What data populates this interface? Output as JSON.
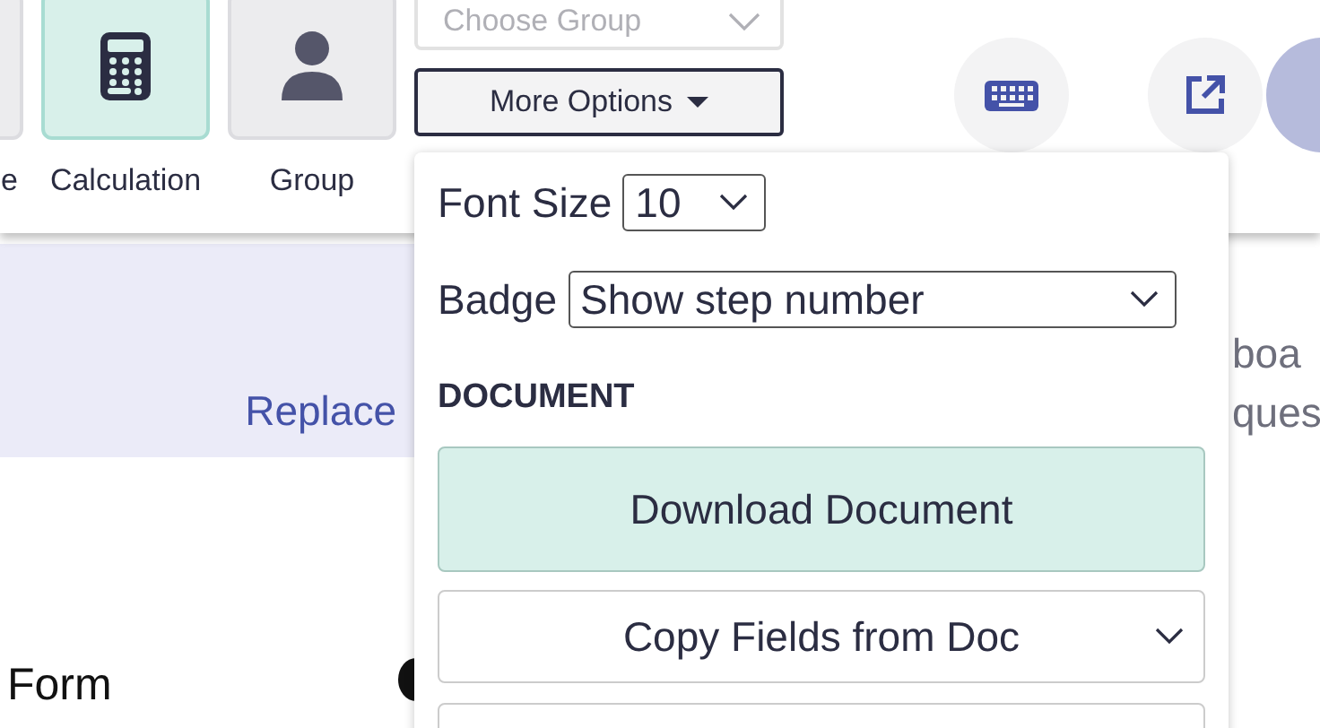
{
  "toolbar": {
    "tiles": [
      {
        "label": "e",
        "selected": false
      },
      {
        "label": "Calculation",
        "selected": true
      },
      {
        "label": "Group",
        "selected": false
      }
    ],
    "group_select": {
      "placeholder": "Choose Group",
      "disabled": true
    },
    "more_options": {
      "label": "More Options"
    }
  },
  "banner": {
    "link": "Replace",
    "right_lines": [
      "boa",
      "ques"
    ]
  },
  "body": {
    "text": "Form"
  },
  "menu": {
    "font_size": {
      "label": "Font Size",
      "value": "10"
    },
    "badge": {
      "label": "Badge",
      "value": "Show step number"
    },
    "section": "DOCUMENT",
    "items": [
      {
        "kind": "button",
        "label": "Download Document"
      },
      {
        "kind": "select",
        "label": "Copy Fields from Doc"
      },
      {
        "kind": "blank"
      }
    ]
  }
}
